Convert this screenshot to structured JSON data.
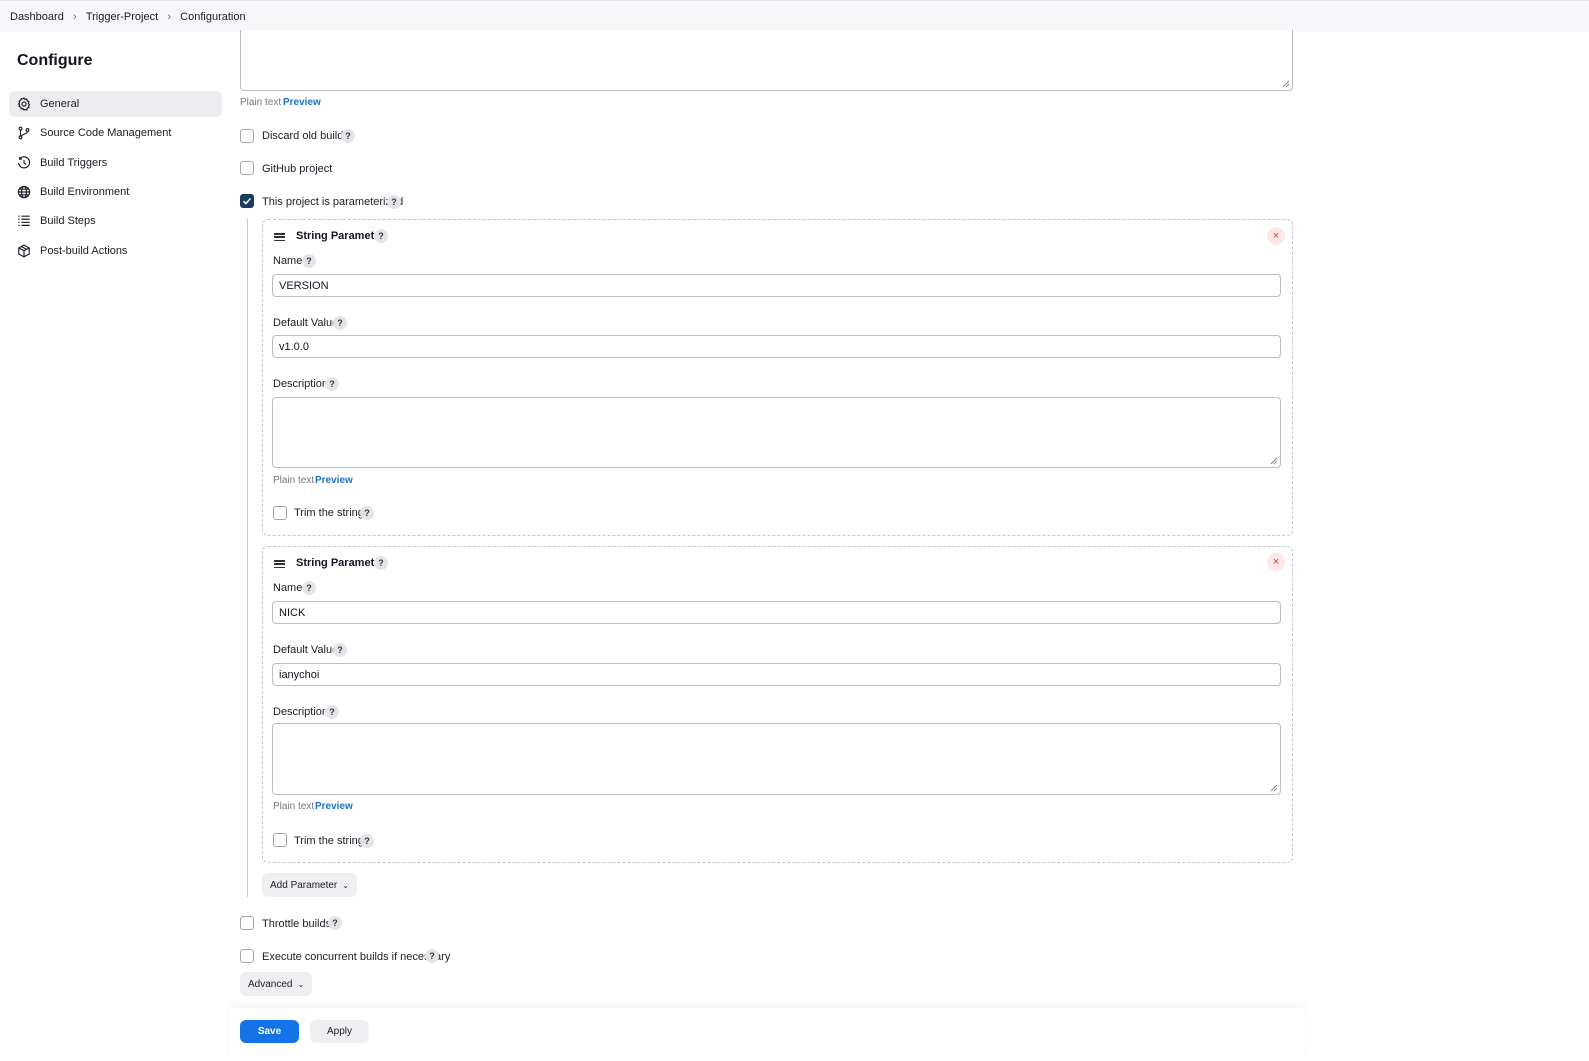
{
  "breadcrumb": [
    "Dashboard",
    "Trigger-Project",
    "Configuration"
  ],
  "sidebar": {
    "title": "Configure",
    "items": [
      {
        "label": "General",
        "icon": "gear-icon",
        "active": true
      },
      {
        "label": "Source Code Management",
        "icon": "branch-icon"
      },
      {
        "label": "Build Triggers",
        "icon": "clock-icon"
      },
      {
        "label": "Build Environment",
        "icon": "globe-icon"
      },
      {
        "label": "Build Steps",
        "icon": "list-icon"
      },
      {
        "label": "Post-build Actions",
        "icon": "package-icon"
      }
    ]
  },
  "description": {
    "plain_text": "Plain text",
    "preview": "Preview"
  },
  "options": {
    "discard_old_builds": "Discard old builds",
    "github_project": "GitHub project",
    "parameterized": "This project is parameterized",
    "throttle_builds": "Throttle builds",
    "concurrent_builds": "Execute concurrent builds if necessary"
  },
  "help_label": "?",
  "close_label": "×",
  "parameters": [
    {
      "type": "String Parameter",
      "name_label": "Name",
      "name_value": "VERSION",
      "default_label": "Default Value",
      "default_value": "v1.0.0",
      "description_label": "Description",
      "plain_text": "Plain text",
      "preview": "Preview",
      "trim_label": "Trim the string"
    },
    {
      "type": "String Parameter",
      "name_label": "Name",
      "name_value": "NICK",
      "default_label": "Default Value",
      "default_value": "ianychoi",
      "description_label": "Description",
      "plain_text": "Plain text",
      "preview": "Preview",
      "trim_label": "Trim the string"
    }
  ],
  "add_parameter": "Add Parameter",
  "advanced": "Advanced",
  "buttons": {
    "save": "Save",
    "apply": "Apply"
  },
  "colors": {
    "accent": "#1473e6",
    "checkbox_checked": "#1b3a5e",
    "link": "#1a73c9",
    "danger": "#d83a3a"
  }
}
